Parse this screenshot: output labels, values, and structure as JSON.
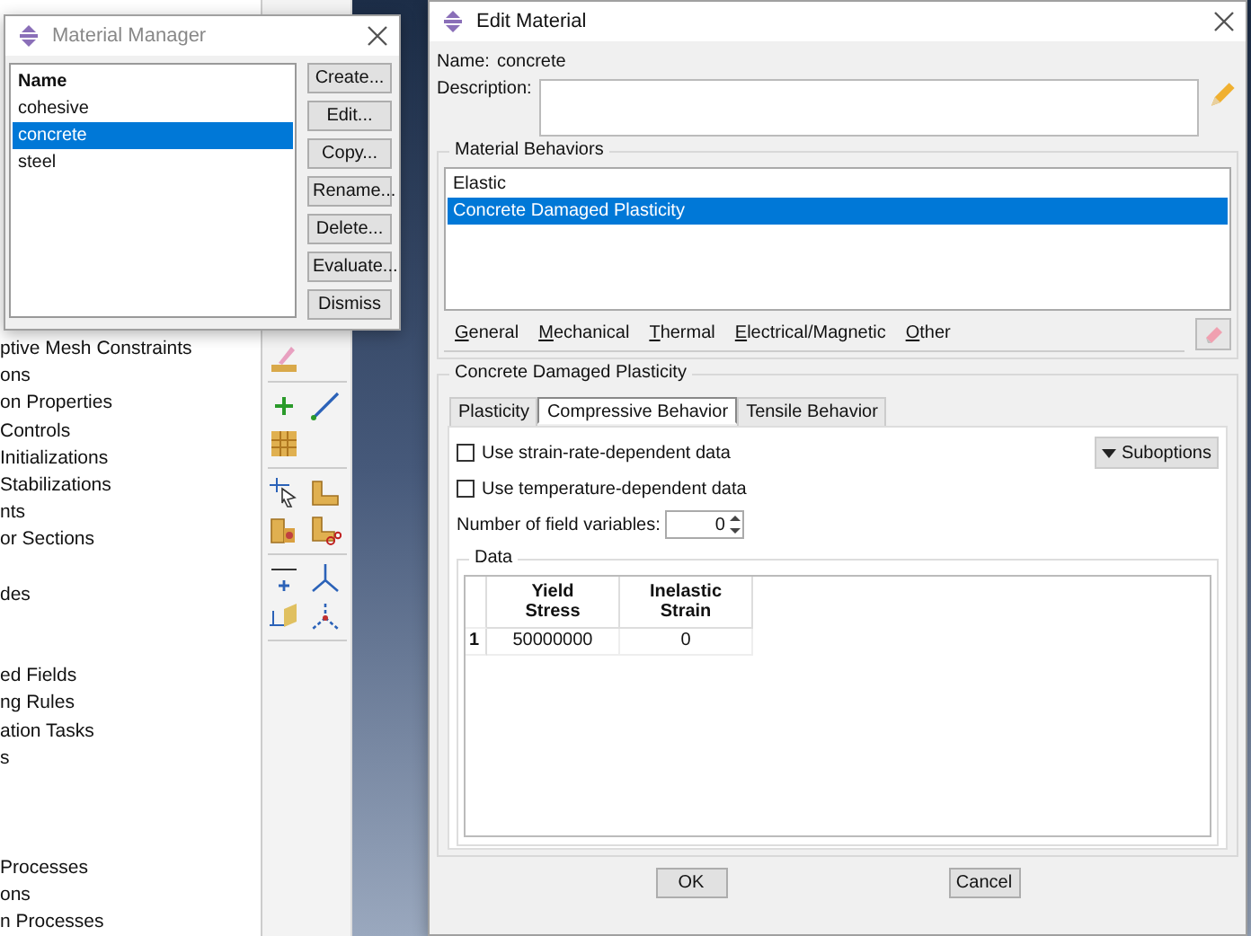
{
  "model_tree": {
    "groups": [
      {
        "items": [
          "ptive Mesh Constraints",
          "ons",
          "on Properties",
          "Controls",
          "Initializations",
          "Stabilizations",
          "nts",
          "or Sections"
        ]
      },
      {
        "items": [
          "des"
        ]
      },
      {
        "items": [
          "ed Fields",
          "ng Rules",
          "ation Tasks",
          "s"
        ]
      },
      {
        "items": [
          "Processes",
          "ons",
          "n Processes"
        ]
      }
    ]
  },
  "material_manager": {
    "title": "Material Manager",
    "column": "Name",
    "materials": [
      {
        "name": "cohesive",
        "selected": false
      },
      {
        "name": "concrete",
        "selected": true
      },
      {
        "name": "steel",
        "selected": false
      }
    ],
    "buttons": [
      "Create...",
      "Edit...",
      "Copy...",
      "Rename...",
      "Delete...",
      "Evaluate...",
      "Dismiss"
    ]
  },
  "edit_material": {
    "title": "Edit Material",
    "name_label": "Name:",
    "name": "concrete",
    "description_label": "Description:",
    "behaviors_title": "Material Behaviors",
    "behaviors": [
      {
        "label": "Elastic",
        "selected": false
      },
      {
        "label": "Concrete Damaged Plasticity",
        "selected": true
      }
    ],
    "menus": [
      "General",
      "Mechanical",
      "Thermal",
      "Electrical/Magnetic",
      "Other"
    ],
    "section_title": "Concrete Damaged Plasticity",
    "tabs": [
      {
        "label": "Plasticity",
        "selected": false
      },
      {
        "label": "Compressive Behavior",
        "selected": true
      },
      {
        "label": "Tensile Behavior",
        "selected": false
      }
    ],
    "checkboxes": [
      {
        "label": "Use strain-rate-dependent data",
        "checked": false
      },
      {
        "label": "Use temperature-dependent data",
        "checked": false
      }
    ],
    "suboptions": "Suboptions",
    "field_variables_label": "Number of field variables:",
    "field_variables": "0",
    "data_title": "Data",
    "table": {
      "columns": [
        "Yield Stress",
        "Inelastic Strain"
      ],
      "rows": [
        {
          "index": "1",
          "cells": [
            "50000000",
            "0"
          ]
        }
      ]
    },
    "buttons": [
      "OK",
      "Cancel"
    ]
  }
}
